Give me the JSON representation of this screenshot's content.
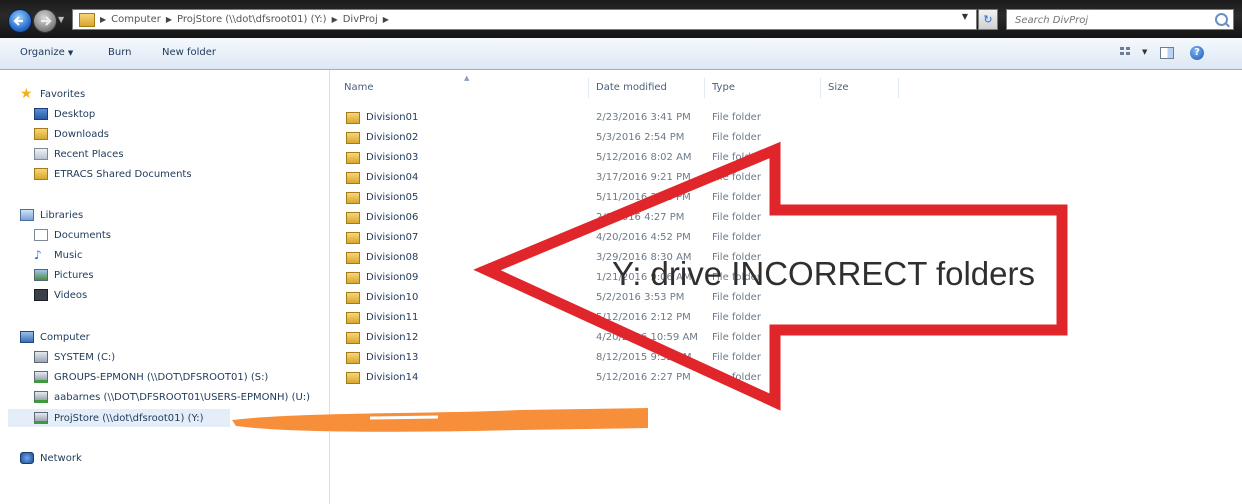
{
  "address_bar": {
    "breadcrumbs": [
      "Computer",
      "ProjStore (\\\\dot\\dfsroot01) (Y:)",
      "DivProj"
    ]
  },
  "search": {
    "placeholder": "Search DivProj"
  },
  "toolbar": {
    "organize": "Organize",
    "burn": "Burn",
    "new_folder": "New folder"
  },
  "nav": {
    "favorites": {
      "label": "Favorites",
      "items": [
        "Desktop",
        "Downloads",
        "Recent Places",
        "ETRACS Shared Documents"
      ]
    },
    "libraries": {
      "label": "Libraries",
      "items": [
        "Documents",
        "Music",
        "Pictures",
        "Videos"
      ]
    },
    "computer": {
      "label": "Computer",
      "items": [
        "SYSTEM (C:)",
        "GROUPS-EPMONH (\\\\DOT\\DFSROOT01) (S:)",
        "aabarnes (\\\\DOT\\DFSROOT01\\USERS-EPMONH) (U:)",
        "ProjStore (\\\\dot\\dfsroot01) (Y:)"
      ]
    },
    "network": {
      "label": "Network"
    }
  },
  "columns": {
    "name": "Name",
    "date": "Date modified",
    "type": "Type",
    "size": "Size"
  },
  "files": [
    {
      "name": "Division01",
      "date": "2/23/2016 3:41 PM",
      "type": "File folder"
    },
    {
      "name": "Division02",
      "date": "5/3/2016 2:54 PM",
      "type": "File folder"
    },
    {
      "name": "Division03",
      "date": "5/12/2016 8:02 AM",
      "type": "File folder"
    },
    {
      "name": "Division04",
      "date": "3/17/2016 9:21 PM",
      "type": "File folder"
    },
    {
      "name": "Division05",
      "date": "5/11/2016 2:26 PM",
      "type": "File folder"
    },
    {
      "name": "Division06",
      "date": "2/8/2016 4:27 PM",
      "type": "File folder"
    },
    {
      "name": "Division07",
      "date": "4/20/2016 4:52 PM",
      "type": "File folder"
    },
    {
      "name": "Division08",
      "date": "3/29/2016 8:30 AM",
      "type": "File folder"
    },
    {
      "name": "Division09",
      "date": "1/21/2016 9:06 AM",
      "type": "File folder"
    },
    {
      "name": "Division10",
      "date": "5/2/2016 3:53 PM",
      "type": "File folder"
    },
    {
      "name": "Division11",
      "date": "5/12/2016 2:12 PM",
      "type": "File folder"
    },
    {
      "name": "Division12",
      "date": "4/20/2016 10:59 AM",
      "type": "File folder"
    },
    {
      "name": "Division13",
      "date": "8/12/2015 9:32 AM",
      "type": "File folder"
    },
    {
      "name": "Division14",
      "date": "5/12/2016 2:27 PM",
      "type": "File folder"
    }
  ],
  "annotation": {
    "text": "Y: drive INCORRECT folders",
    "arrow_color": "#e0262a",
    "highlight_color": "#f7882f"
  }
}
